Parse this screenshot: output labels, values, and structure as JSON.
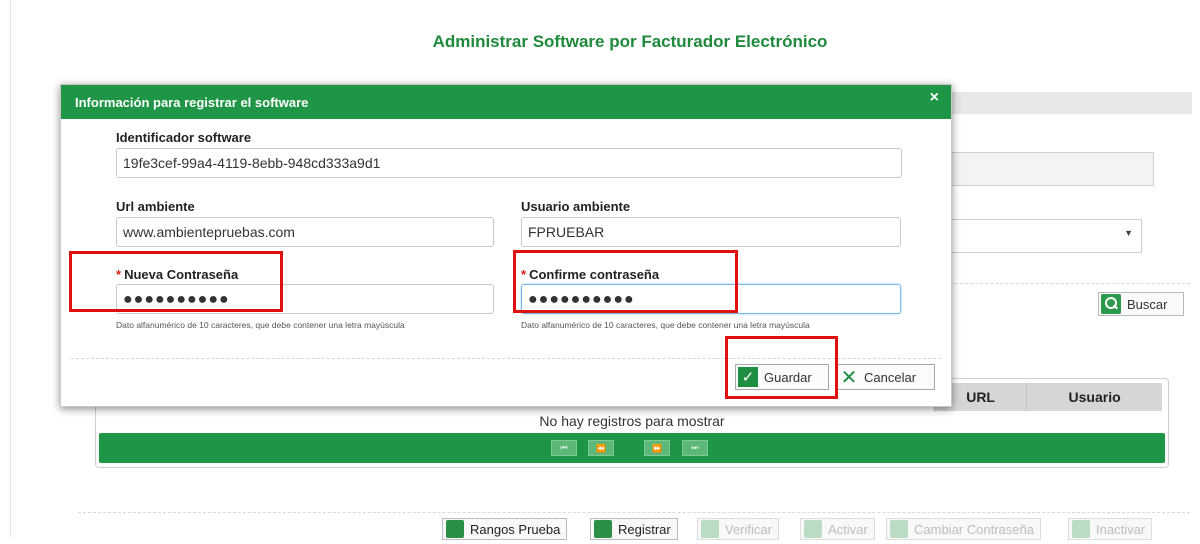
{
  "page": {
    "title": "Administrar Software por Facturador Electrónico",
    "search_button": "Buscar"
  },
  "grid": {
    "columns": [
      "URL",
      "Usuario"
    ],
    "empty_message": "No hay registros para mostrar",
    "pager": {
      "first": "⏮",
      "prev": "⏪",
      "next": "⏩",
      "last": "⏭"
    }
  },
  "bottom_toolbar": {
    "rangos_prueba": "Rangos Prueba",
    "registrar": "Registrar",
    "verificar": "Verificar",
    "activar": "Activar",
    "cambiar_contrasena": "Cambiar Contraseña",
    "inactivar": "Inactivar"
  },
  "modal": {
    "title": "Información para registrar el software",
    "close": "×",
    "identificador": {
      "label": "Identificador software",
      "value": "19fe3cef-99a4-4119-8ebb-948cd333a9d1"
    },
    "url": {
      "label": "Url ambiente",
      "value": "www.ambientepruebas.com"
    },
    "usuario": {
      "label": "Usuario ambiente",
      "value": "FPRUEBAR"
    },
    "nueva_contrasena": {
      "required_mark": "*",
      "label": "Nueva Contraseña",
      "value": "●●●●●●●●●●",
      "hint": "Dato alfanumérico de 10 caracteres, que debe contener una letra mayúscula"
    },
    "confirme_contrasena": {
      "required_mark": "*",
      "label": "Confirme contraseña",
      "value": "●●●●●●●●●●",
      "hint": "Dato alfanumérico de 10 caracteres, que debe contener una letra mayúscula"
    },
    "guardar": "Guardar",
    "cancelar": "Cancelar"
  },
  "colors": {
    "brand_green": "#1f9645",
    "title_green": "#1f8a3c",
    "annotation_red": "#e01010"
  }
}
